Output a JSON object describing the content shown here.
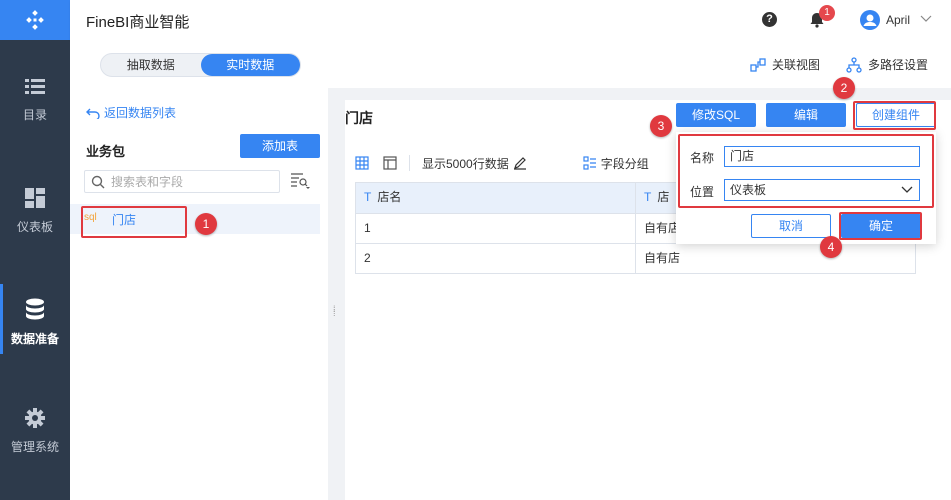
{
  "app": {
    "title": "FineBI商业智能",
    "accent": "#3685f2",
    "sidebar_bg": "#2d3a4b",
    "callout_color": "#e0393f"
  },
  "header": {
    "notification_count": "1",
    "user_name": "April"
  },
  "sidebar": {
    "items": [
      {
        "label": "目录",
        "icon": "list-icon"
      },
      {
        "label": "仪表板",
        "icon": "dashboard-icon"
      },
      {
        "label": "数据准备",
        "icon": "database-icon"
      },
      {
        "label": "管理系统",
        "icon": "gear-icon"
      }
    ]
  },
  "subbar": {
    "tabs": [
      "抽取数据",
      "实时数据"
    ],
    "active_tab": "实时数据",
    "relation_view": "关联视图",
    "multipath": "多路径设置"
  },
  "left": {
    "back_label": "返回数据列表",
    "package_title": "业务包",
    "add_table_label": "添加表",
    "search_placeholder": "搜索表和字段",
    "table_tag": "sql",
    "table_name": "门店"
  },
  "main": {
    "title": "门店",
    "buttons": {
      "edit_sql": "修改SQL",
      "edit": "编辑",
      "create_component": "创建组件"
    },
    "toolbar": {
      "show_rows": "显示5000行数据",
      "field_group": "字段分组"
    },
    "table": {
      "headers": [
        "店名",
        "店"
      ],
      "rows": [
        [
          "1",
          "自有店"
        ],
        [
          "2",
          "自有店"
        ]
      ]
    }
  },
  "popover": {
    "name_label": "名称",
    "name_value": "门店",
    "location_label": "位置",
    "location_value": "仪表板",
    "cancel_label": "取消",
    "confirm_label": "确定"
  },
  "callouts": [
    "1",
    "2",
    "3",
    "4"
  ]
}
